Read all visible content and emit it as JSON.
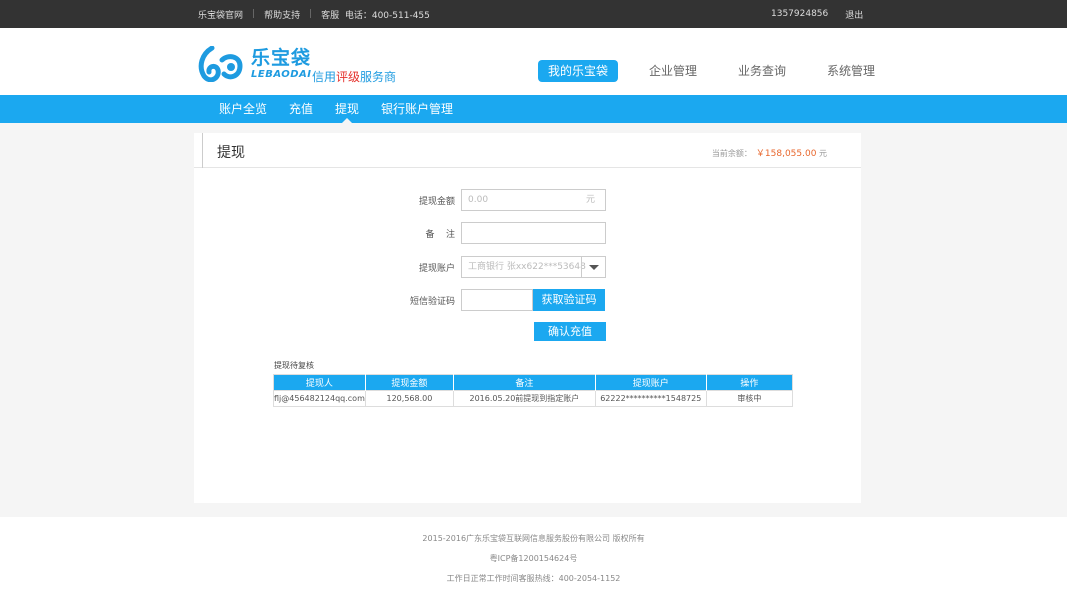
{
  "topbar": {
    "official_site": "乐宝袋官网",
    "help": "帮助支持",
    "service": "客服  电话：400-511-455",
    "phone_user": "1357924856",
    "logout": "退出"
  },
  "logo": {
    "brand": "乐宝袋",
    "latin": "LEBAODAI",
    "slogan_part1": "信用",
    "slogan_red": "评级",
    "slogan_part2": "服务商"
  },
  "main_nav": {
    "items": [
      {
        "label": "我的乐宝袋",
        "active": true
      },
      {
        "label": "企业管理"
      },
      {
        "label": "业务查询"
      },
      {
        "label": "系统管理"
      }
    ]
  },
  "sub_nav": {
    "items": [
      {
        "label": "账户全览"
      },
      {
        "label": "充值"
      },
      {
        "label": "提现",
        "active": true
      },
      {
        "label": "银行账户管理"
      }
    ]
  },
  "page": {
    "title": "提现",
    "balance_label": "当前余额：",
    "balance_value": "￥158,055.00",
    "balance_unit": "元"
  },
  "form": {
    "amount_label": "提现金额",
    "amount_placeholder": "0.00",
    "amount_unit": "元",
    "remark_label": "备    注",
    "account_label": "提现账户",
    "account_value": "工商银行 张xx622***53648",
    "sms_label": "短信验证码",
    "get_code_button": "获取验证码",
    "submit_button": "确认充值"
  },
  "records": {
    "title": "提现待复核",
    "columns": [
      "提现人",
      "提现金额",
      "备注",
      "提现账户",
      "操作"
    ],
    "rows": [
      [
        "flj@456482124qq.com",
        "120,568.00",
        "2016.05.20前提现到指定账户",
        "62222**********1548725",
        "审核中"
      ]
    ]
  },
  "footer": {
    "copyright": "2015-2016广东乐宝袋互联网信息服务股份有限公司 版权所有",
    "icp": "粤ICP备1200154624号",
    "hotline": "工作日正常工作时间客服热线：400-2054-1152"
  },
  "colors": {
    "accent": "#1ba8f0",
    "topbar": "#333333",
    "balance": "#e8672d",
    "slogan_red": "#e5322d"
  }
}
